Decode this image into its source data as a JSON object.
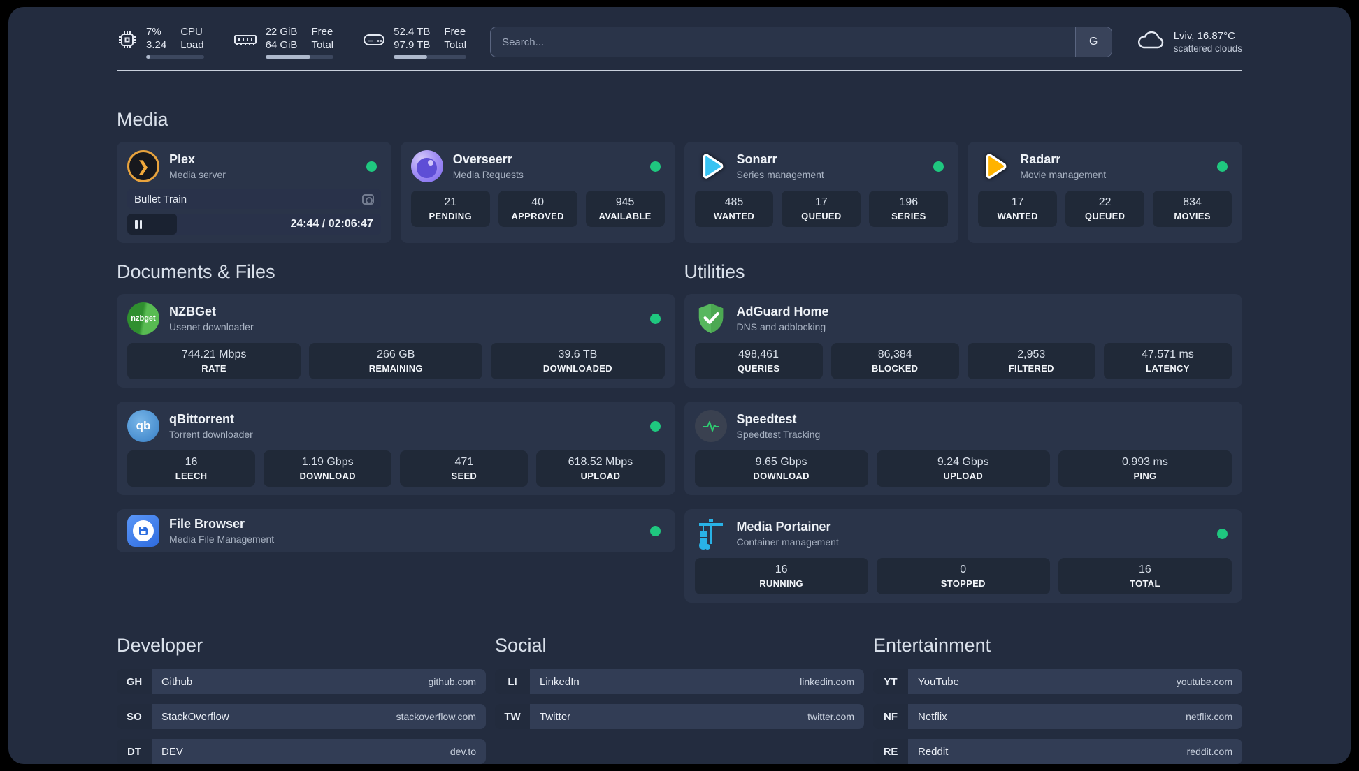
{
  "header": {
    "system_stats": [
      {
        "icon": "cpu-icon",
        "rows": [
          {
            "value": "7%",
            "label": "CPU"
          },
          {
            "value": "3.24",
            "label": "Load"
          }
        ],
        "progress": 7
      },
      {
        "icon": "memory-icon",
        "rows": [
          {
            "value": "22 GiB",
            "label": "Free"
          },
          {
            "value": "64 GiB",
            "label": "Total"
          }
        ],
        "progress": 66
      },
      {
        "icon": "disk-icon",
        "rows": [
          {
            "value": "52.4 TB",
            "label": "Free"
          },
          {
            "value": "97.9 TB",
            "label": "Total"
          }
        ],
        "progress": 46
      }
    ],
    "search": {
      "placeholder": "Search...",
      "button_label": "G"
    },
    "weather": {
      "location": "Lviv, 16.87°C",
      "condition": "scattered clouds"
    }
  },
  "sections": {
    "media": {
      "title": "Media",
      "cards": [
        {
          "name": "Plex",
          "subtitle": "Media server",
          "status": "online",
          "player": {
            "track": "Bullet Train",
            "time": "24:44 / 02:06:47",
            "progress": 19.5
          }
        },
        {
          "name": "Overseerr",
          "subtitle": "Media Requests",
          "status": "online",
          "stats": [
            {
              "value": "21",
              "label": "PENDING"
            },
            {
              "value": "40",
              "label": "APPROVED"
            },
            {
              "value": "945",
              "label": "AVAILABLE"
            }
          ]
        },
        {
          "name": "Sonarr",
          "subtitle": "Series management",
          "status": "online",
          "stats": [
            {
              "value": "485",
              "label": "WANTED"
            },
            {
              "value": "17",
              "label": "QUEUED"
            },
            {
              "value": "196",
              "label": "SERIES"
            }
          ]
        },
        {
          "name": "Radarr",
          "subtitle": "Movie management",
          "status": "online",
          "stats": [
            {
              "value": "17",
              "label": "WANTED"
            },
            {
              "value": "22",
              "label": "QUEUED"
            },
            {
              "value": "834",
              "label": "MOVIES"
            }
          ]
        }
      ]
    },
    "documents": {
      "title": "Documents & Files",
      "cards": [
        {
          "name": "NZBGet",
          "subtitle": "Usenet downloader",
          "status": "online",
          "icon_text": "nzbget",
          "stats": [
            {
              "value": "744.21 Mbps",
              "label": "RATE"
            },
            {
              "value": "266 GB",
              "label": "REMAINING"
            },
            {
              "value": "39.6 TB",
              "label": "DOWNLOADED"
            }
          ]
        },
        {
          "name": "qBittorrent",
          "subtitle": "Torrent downloader",
          "status": "online",
          "icon_text": "qb",
          "stats": [
            {
              "value": "16",
              "label": "LEECH"
            },
            {
              "value": "1.19 Gbps",
              "label": "DOWNLOAD"
            },
            {
              "value": "471",
              "label": "SEED"
            },
            {
              "value": "618.52 Mbps",
              "label": "UPLOAD"
            }
          ]
        },
        {
          "name": "File Browser",
          "subtitle": "Media File Management",
          "status": "online"
        }
      ]
    },
    "utilities": {
      "title": "Utilities",
      "cards": [
        {
          "name": "AdGuard Home",
          "subtitle": "DNS and adblocking",
          "stats": [
            {
              "value": "498,461",
              "label": "QUERIES"
            },
            {
              "value": "86,384",
              "label": "BLOCKED"
            },
            {
              "value": "2,953",
              "label": "FILTERED"
            },
            {
              "value": "47.571 ms",
              "label": "LATENCY"
            }
          ]
        },
        {
          "name": "Speedtest",
          "subtitle": "Speedtest Tracking",
          "stats": [
            {
              "value": "9.65 Gbps",
              "label": "DOWNLOAD"
            },
            {
              "value": "9.24 Gbps",
              "label": "UPLOAD"
            },
            {
              "value": "0.993 ms",
              "label": "PING"
            }
          ]
        },
        {
          "name": "Media Portainer",
          "subtitle": "Container management",
          "status": "online",
          "stats": [
            {
              "value": "16",
              "label": "RUNNING"
            },
            {
              "value": "0",
              "label": "STOPPED"
            },
            {
              "value": "16",
              "label": "TOTAL"
            }
          ]
        }
      ]
    },
    "bookmarks": [
      {
        "title": "Developer",
        "links": [
          {
            "abbr": "GH",
            "name": "Github",
            "url": "github.com"
          },
          {
            "abbr": "SO",
            "name": "StackOverflow",
            "url": "stackoverflow.com"
          },
          {
            "abbr": "DT",
            "name": "DEV",
            "url": "dev.to"
          }
        ]
      },
      {
        "title": "Social",
        "links": [
          {
            "abbr": "LI",
            "name": "LinkedIn",
            "url": "linkedin.com"
          },
          {
            "abbr": "TW",
            "name": "Twitter",
            "url": "twitter.com"
          }
        ]
      },
      {
        "title": "Entertainment",
        "links": [
          {
            "abbr": "YT",
            "name": "YouTube",
            "url": "youtube.com"
          },
          {
            "abbr": "NF",
            "name": "Netflix",
            "url": "netflix.com"
          },
          {
            "abbr": "RE",
            "name": "Reddit",
            "url": "reddit.com"
          }
        ]
      }
    ]
  },
  "colors": {
    "status_online": "#1FC77F",
    "frame_bg": "#232C3F",
    "card_bg": "#2A3449"
  }
}
